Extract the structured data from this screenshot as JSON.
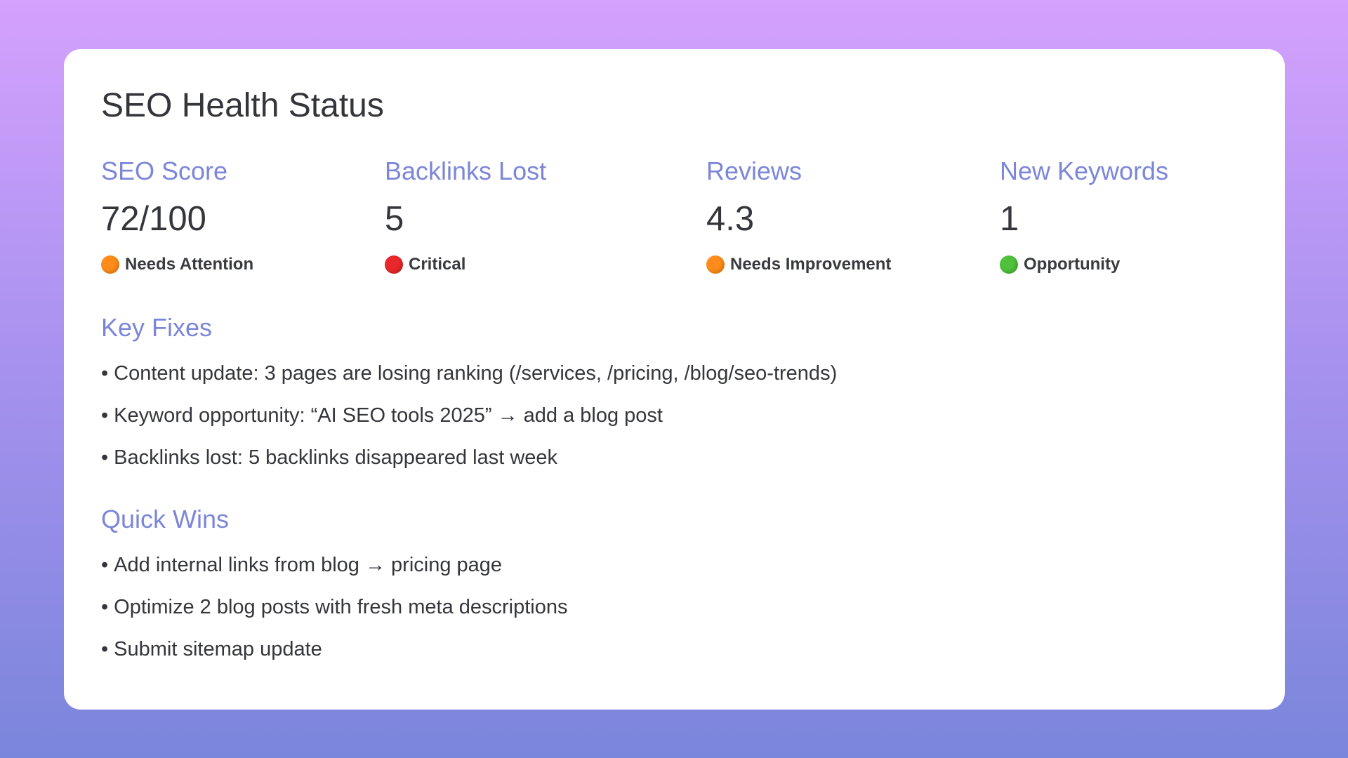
{
  "card": {
    "title": "SEO Health Status"
  },
  "metrics": [
    {
      "label": "SEO Score",
      "value": "72/100",
      "status": "Needs Attention",
      "status_color": "#ff8c1a",
      "status_icon": "orange-circle-icon"
    },
    {
      "label": "Backlinks Lost",
      "value": "5",
      "status": "Critical",
      "status_color": "#e8282b",
      "status_icon": "red-circle-icon"
    },
    {
      "label": "Reviews",
      "value": "4.3",
      "status": "Needs Improvement",
      "status_color": "#ff8c1a",
      "status_icon": "orange-circle-icon"
    },
    {
      "label": "New Keywords",
      "value": "1",
      "status": "Opportunity",
      "status_color": "#4fc13a",
      "status_icon": "green-circle-icon"
    }
  ],
  "key_fixes": {
    "heading": "Key Fixes",
    "items": [
      "Content update: 3 pages are losing ranking (/services, /pricing, /blog/seo-trends)",
      "Keyword opportunity: “AI SEO tools 2025” → add a blog post",
      "Backlinks lost: 5 backlinks disappeared last week"
    ]
  },
  "quick_wins": {
    "heading": "Quick Wins",
    "items": [
      "Add internal links from blog → pricing page",
      "Optimize 2 blog posts with fresh meta descriptions",
      "Submit sitemap update"
    ]
  },
  "bullet": "•",
  "colors": {
    "accent": "#7b86d9",
    "text": "#35363c",
    "card_bg": "#ffffff",
    "bg_top": "#d4a1fd",
    "bg_bottom": "#7a86db"
  }
}
